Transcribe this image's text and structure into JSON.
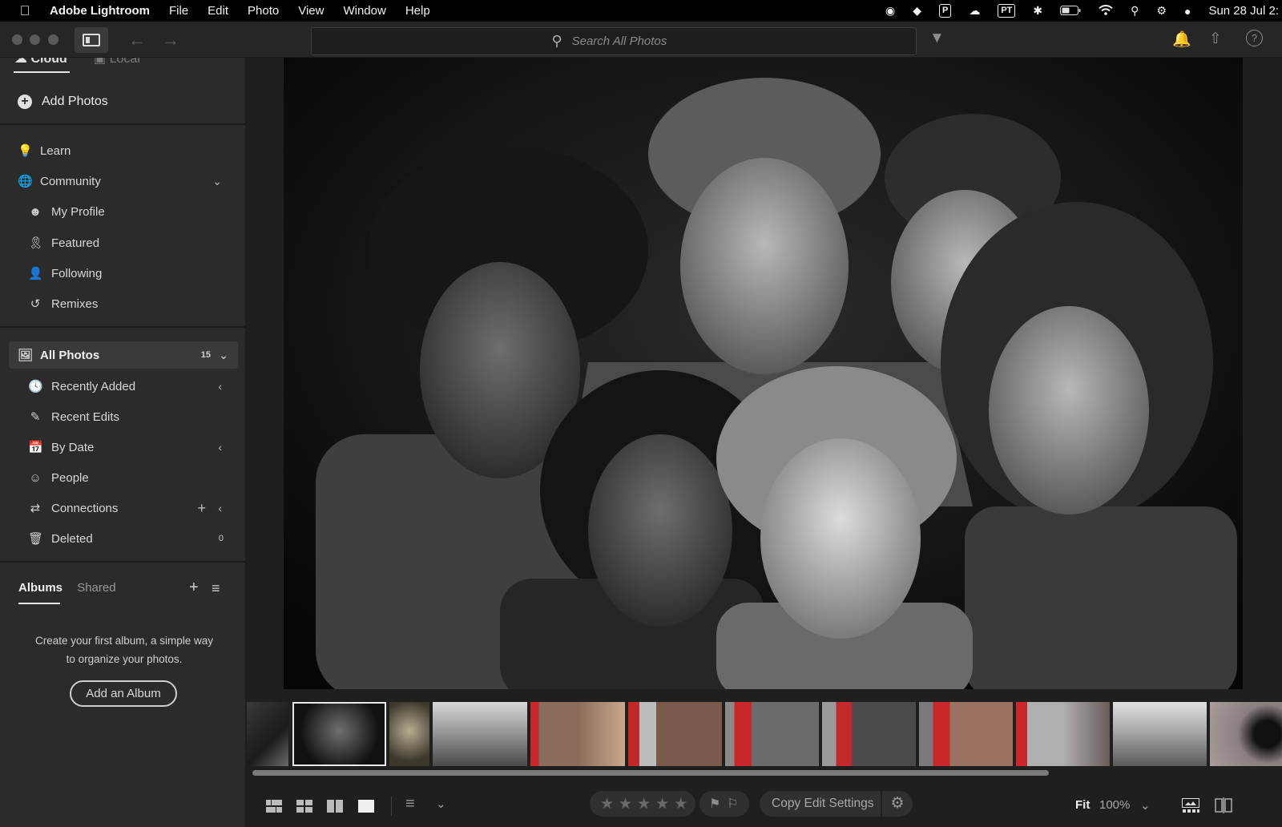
{
  "menubar": {
    "app_name": "Adobe Lightroom",
    "menus": [
      "File",
      "Edit",
      "Photo",
      "View",
      "Window",
      "Help"
    ],
    "status_icons": [
      "grammarly-icon",
      "dashlane-icon",
      "p-icon",
      "creative-cloud-icon",
      "pt-icon",
      "bluetooth-icon",
      "battery-icon",
      "wifi-icon",
      "spotlight-icon",
      "control-center-icon",
      "siri-icon"
    ],
    "pt_label": "PT",
    "p_label": "P",
    "clock": "Sun 28 Jul 2:"
  },
  "toolbar": {
    "search_placeholder": "Search All Photos"
  },
  "sidebar": {
    "storage_tabs": {
      "cloud": "Cloud",
      "local": "Local"
    },
    "add_photos": "Add Photos",
    "learn": "Learn",
    "community": "Community",
    "community_items": [
      "My Profile",
      "Featured",
      "Following",
      "Remixes"
    ],
    "all_photos": {
      "label": "All Photos",
      "count": "15"
    },
    "library_items": [
      "Recently Added",
      "Recent Edits",
      "By Date",
      "People",
      "Connections",
      "Deleted"
    ],
    "deleted_count": "0",
    "albums_tab": "Albums",
    "shared_tab": "Shared",
    "empty_albums_text": "Create your first album, a simple way to organize your photos.",
    "add_album": "Add an Album"
  },
  "bottombar": {
    "copy_edit_settings": "Copy Edit Settings",
    "fit": "Fit",
    "zoom": "100%"
  },
  "colors": {
    "sidebar_bg": "#2b2b2b",
    "main_bg": "#1f1f1f",
    "selected_row": "#3a3a3a"
  }
}
